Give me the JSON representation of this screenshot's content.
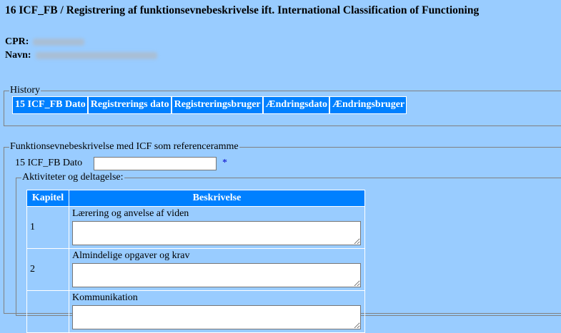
{
  "page": {
    "title": "16 ICF_FB / Registrering af funktionsevnebeskrivelse ift. International Classification of Functioning"
  },
  "patient": {
    "cpr_label": "CPR:",
    "navn_label": "Navn:"
  },
  "history": {
    "legend": "History",
    "columns": [
      "15 ICF_FB Dato",
      "Registrerings dato",
      "Registreringsbruger",
      "Ændringsdato",
      "Ændringsbruger"
    ]
  },
  "funktion": {
    "legend": "Funktionsevnebeskrivelse med ICF som referenceramme",
    "dato_label": "15 ICF_FB Dato",
    "required_marker": "*"
  },
  "aktiviteter": {
    "legend": "Aktiviteter og deltagelse:",
    "headers": {
      "kapitel": "Kapitel",
      "beskrivelse": "Beskrivelse"
    },
    "rows": [
      {
        "kapitel": "1",
        "label": "Lærering og anvelse af viden"
      },
      {
        "kapitel": "2",
        "label": "Almindelige opgaver og krav"
      },
      {
        "kapitel": "",
        "label": "Kommunikation"
      }
    ]
  },
  "colors": {
    "background": "#99ccff",
    "header": "#0080ff",
    "required": "#0000cc"
  }
}
